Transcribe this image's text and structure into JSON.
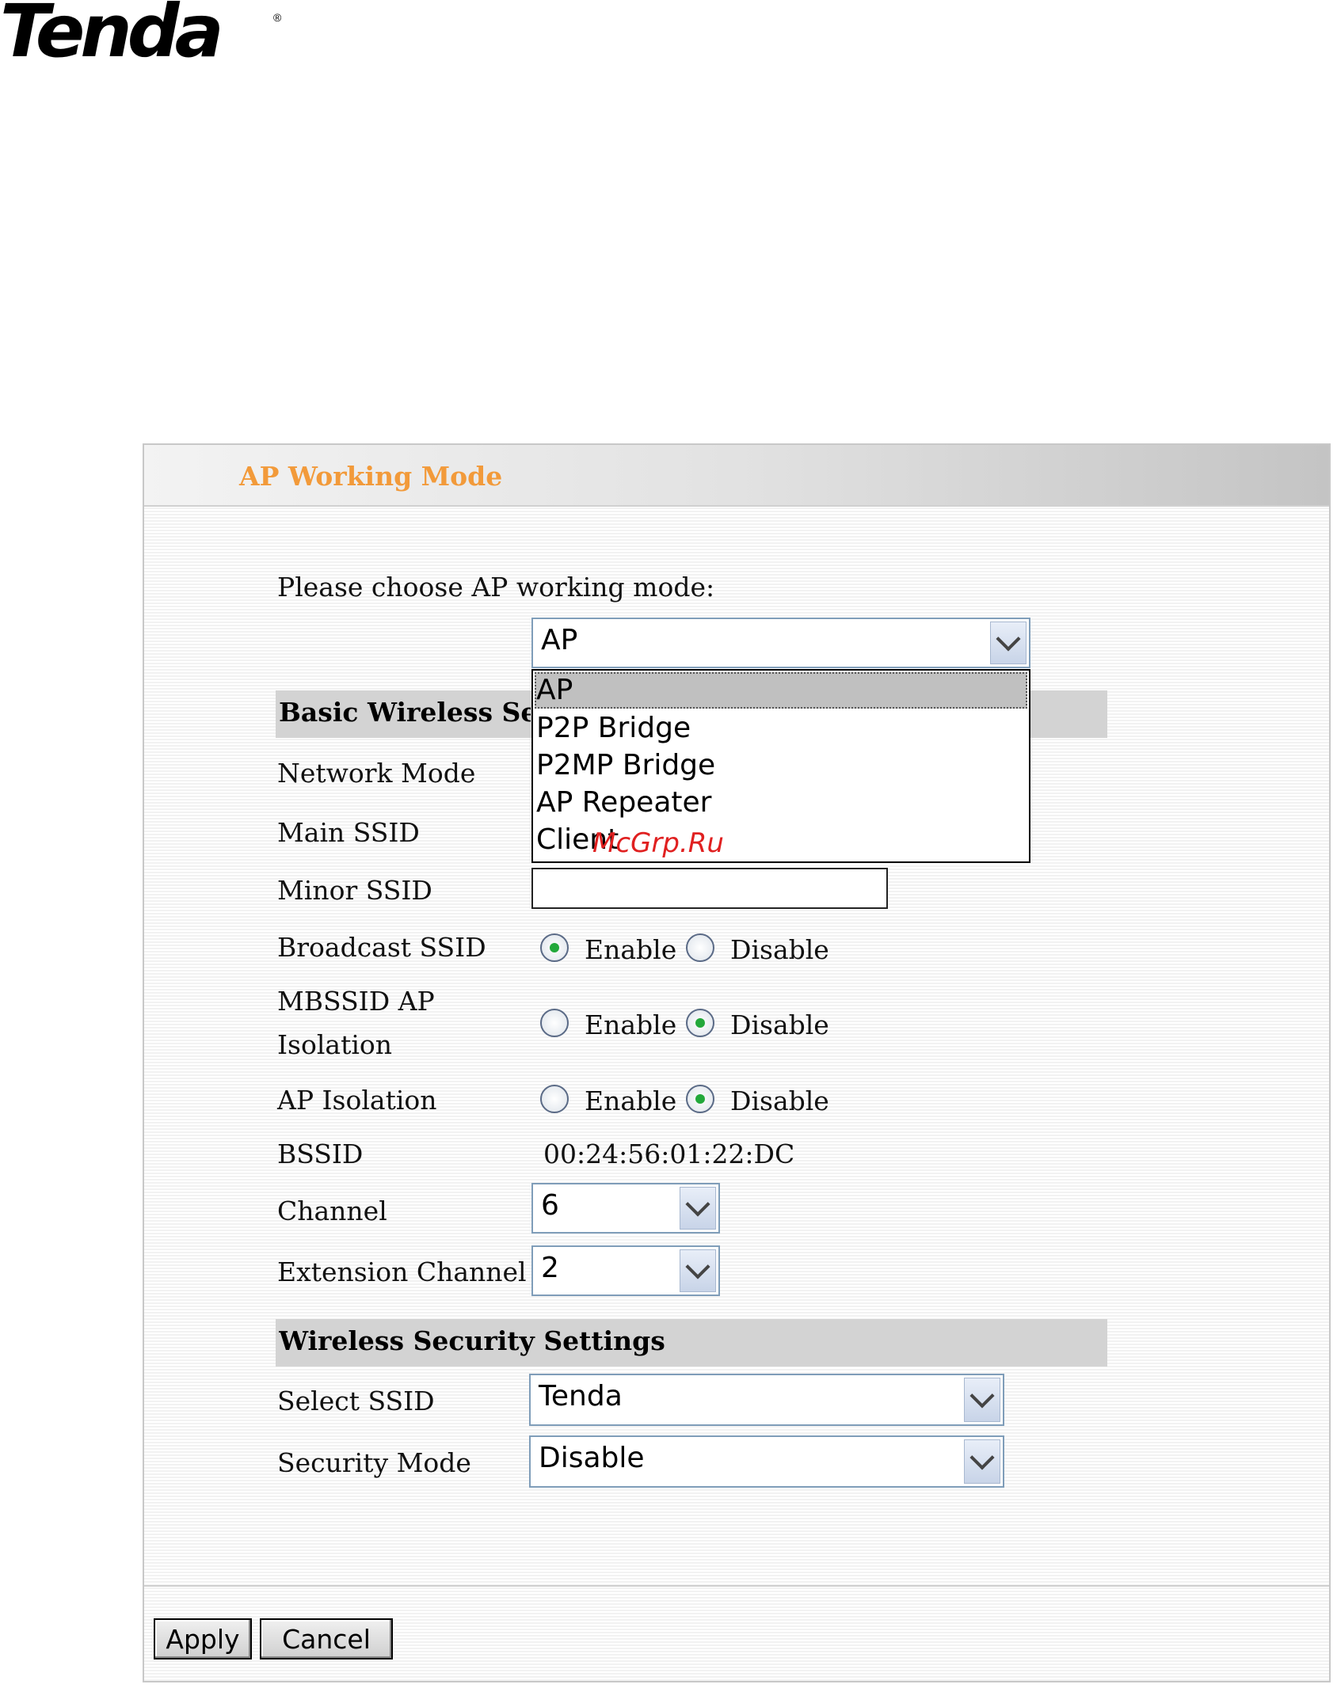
{
  "logo": {
    "text": "Tenda",
    "reg": "®"
  },
  "panel": {
    "title": "AP Working Mode"
  },
  "mode": {
    "prompt": "Please choose AP working mode:",
    "selected": "AP",
    "options": [
      "AP",
      "P2P Bridge",
      "P2MP Bridge",
      "AP Repeater",
      "Client"
    ]
  },
  "basic": {
    "title": "Basic Wireless Settings",
    "network_mode_label": "Network Mode",
    "main_ssid_label": "Main SSID",
    "minor_ssid_label": "Minor SSID",
    "minor_ssid_value": "",
    "broadcast_label": "Broadcast SSID",
    "mbssid_label_1": "MBSSID AP",
    "mbssid_label_2": "Isolation",
    "ap_isolation_label": "AP Isolation",
    "enable": "Enable",
    "disable": "Disable",
    "bssid_label": "BSSID",
    "bssid_value": "00:24:56:01:22:DC",
    "channel_label": "Channel",
    "channel_value": "6",
    "ext_channel_label": "Extension Channel",
    "ext_channel_value": "2"
  },
  "radios": {
    "broadcast_ssid": "Enable",
    "mbssid_isolation": "Disable",
    "ap_isolation": "Disable"
  },
  "security": {
    "title": "Wireless Security Settings",
    "select_ssid_label": "Select SSID",
    "select_ssid_value": "Tenda",
    "mode_label": "Security Mode",
    "mode_value": "Disable"
  },
  "buttons": {
    "apply": "Apply",
    "cancel": "Cancel"
  },
  "watermark": "McGrp.Ru",
  "colors": {
    "title": "#f29a3a",
    "section_bar": "#d3d3d3",
    "radio_dot": "#22a83a",
    "watermark": "#e02020"
  }
}
